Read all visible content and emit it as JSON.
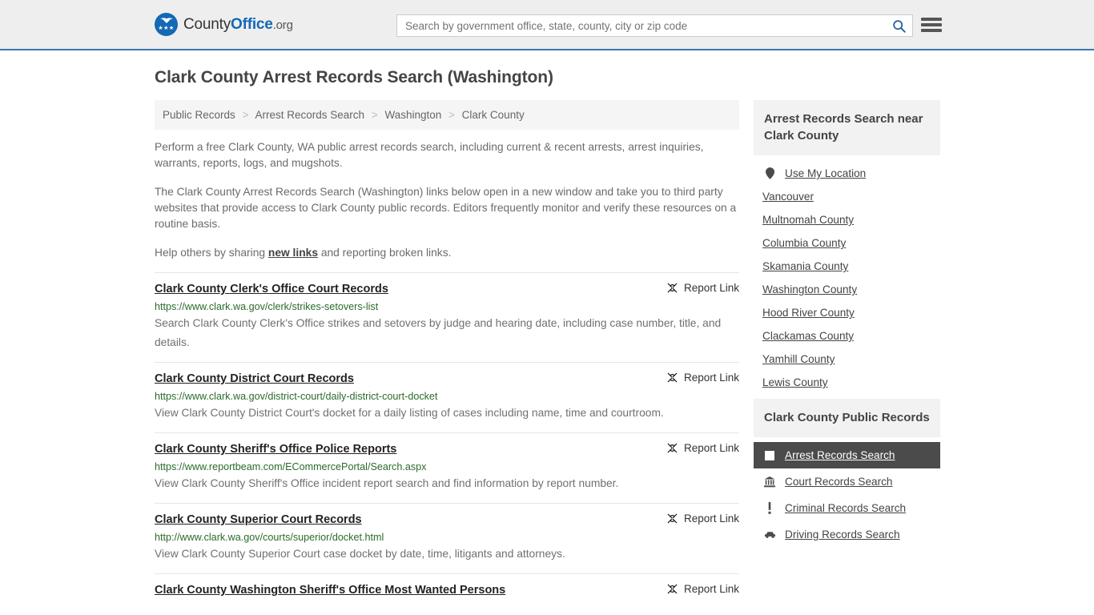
{
  "header": {
    "logo": {
      "part1": "County",
      "part2": "Office",
      "part3": ".org",
      "stars": "★★★"
    },
    "search": {
      "placeholder": "Search by government office, state, county, city or zip code",
      "value": ""
    },
    "search_icon": "search-icon",
    "menu_icon": "hamburger-menu-icon"
  },
  "page": {
    "title": "Clark County Arrest Records Search (Washington)"
  },
  "breadcrumb": {
    "items": [
      "Public Records",
      "Arrest Records Search",
      "Washington",
      "Clark County"
    ],
    "separator": ">"
  },
  "intro": {
    "p1": "Perform a free Clark County, WA public arrest records search, including current & recent arrests, arrest inquiries, warrants, reports, logs, and mugshots.",
    "p2": "The Clark County Arrest Records Search (Washington) links below open in a new window and take you to third party websites that provide access to Clark County public records. Editors frequently monitor and verify these resources on a routine basis.",
    "p3_before": "Help others by sharing ",
    "p3_link": "new links",
    "p3_after": " and reporting broken links."
  },
  "results": {
    "report_label": "Report Link",
    "report_icon": "broken-link-icon",
    "items": [
      {
        "title": "Clark County Clerk's Office Court Records",
        "url": "https://www.clark.wa.gov/clerk/strikes-setovers-list",
        "description": "Search Clark County Clerk's Office strikes and setovers by judge and hearing date, including case number, title, and details."
      },
      {
        "title": "Clark County District Court Records",
        "url": "https://www.clark.wa.gov/district-court/daily-district-court-docket",
        "description": "View Clark County District Court's docket for a daily listing of cases including name, time and courtroom."
      },
      {
        "title": "Clark County Sheriff's Office Police Reports",
        "url": "https://www.reportbeam.com/ECommercePortal/Search.aspx",
        "description": "View Clark County Sheriff's Office incident report search and find information by report number."
      },
      {
        "title": "Clark County Superior Court Records",
        "url": "http://www.clark.wa.gov/courts/superior/docket.html",
        "description": "View Clark County Superior Court case docket by date, time, litigants and attorneys."
      },
      {
        "title": "Clark County Washington Sheriff's Office Most Wanted Persons",
        "url": "",
        "description": ""
      }
    ]
  },
  "sidebar": {
    "nearby": {
      "heading": "Arrest Records Search near Clark County",
      "use_my_location": {
        "label": "Use My Location",
        "icon": "map-pin-icon"
      },
      "links": [
        "Vancouver",
        "Multnomah County",
        "Columbia County",
        "Skamania County",
        "Washington County",
        "Hood River County",
        "Clackamas County",
        "Yamhill County",
        "Lewis County"
      ]
    },
    "public_records": {
      "heading": "Clark County Public Records",
      "items": [
        {
          "label": "Arrest Records Search",
          "icon": "handcuffs-icon",
          "active": true
        },
        {
          "label": "Court Records Search",
          "icon": "courthouse-icon",
          "active": false
        },
        {
          "label": "Criminal Records Search",
          "icon": "exclamation-icon",
          "active": false
        },
        {
          "label": "Driving Records Search",
          "icon": "car-icon",
          "active": false
        }
      ]
    }
  },
  "colors": {
    "header_bg": "#eeeeee",
    "header_border": "#3b76ad",
    "brand_blue": "#1469b5",
    "url_green": "#2a6b2a",
    "active_bg": "#4b4b4b",
    "panel_bg": "#f2f2f2"
  }
}
